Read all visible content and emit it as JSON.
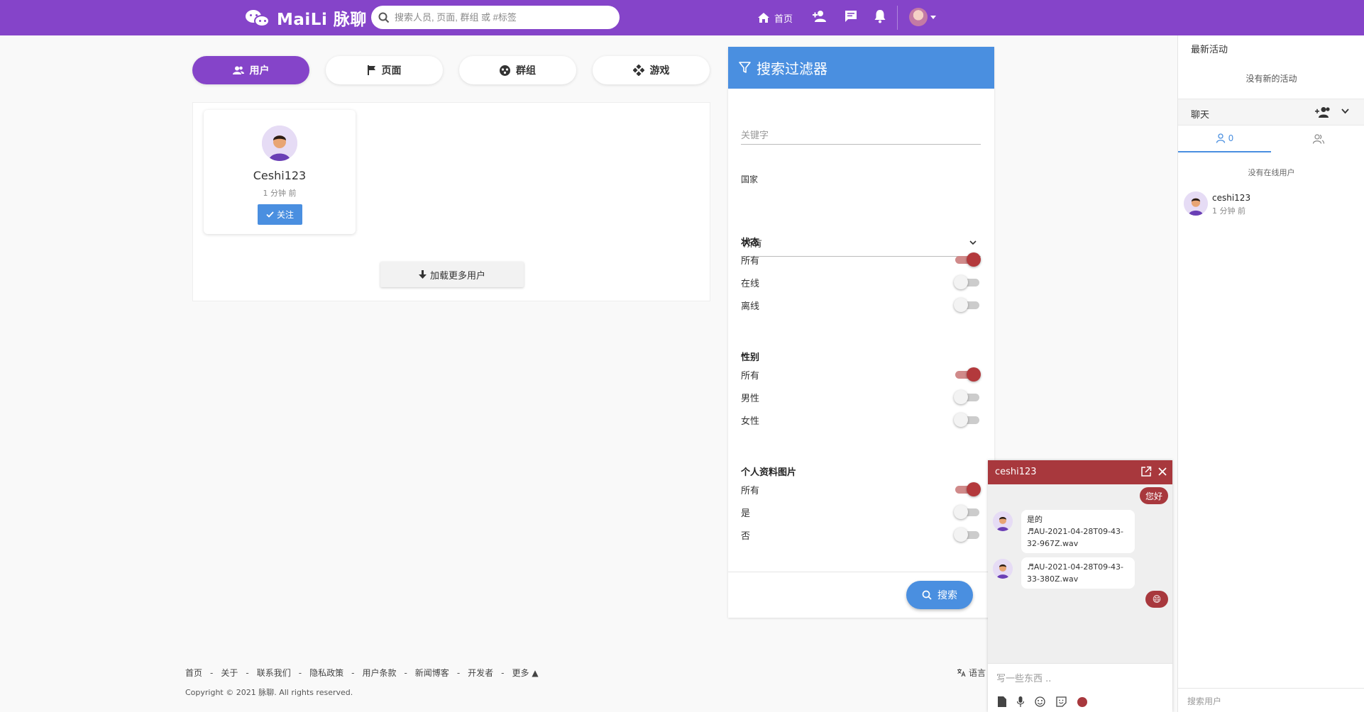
{
  "app": {
    "brand": "MaiLi 脉聊",
    "search_placeholder": "搜索人员, 页面, 群组 或 #标签",
    "nav_home": "首页"
  },
  "tabs": [
    {
      "label": "用户",
      "icon": "users-icon",
      "active": true
    },
    {
      "label": "页面",
      "icon": "flag-icon",
      "active": false
    },
    {
      "label": "群组",
      "icon": "group-icon",
      "active": false
    },
    {
      "label": "游戏",
      "icon": "gamepad-icon",
      "active": false
    }
  ],
  "users": {
    "card": {
      "name": "Ceshi123",
      "time": "1 分钟 前",
      "follow_label": "关注"
    },
    "load_more": "加载更多用户"
  },
  "filter": {
    "title": "搜索过滤器",
    "keyword_placeholder": "关键字",
    "country_label": "国家",
    "country_value": "所有",
    "status_title": "状态",
    "status_options": [
      {
        "label": "所有",
        "on": true
      },
      {
        "label": "在线",
        "on": false
      },
      {
        "label": "离线",
        "on": false
      }
    ],
    "gender_title": "性别",
    "gender_options": [
      {
        "label": "所有",
        "on": true
      },
      {
        "label": "男性",
        "on": false
      },
      {
        "label": "女性",
        "on": false
      }
    ],
    "photo_title": "个人资料图片",
    "photo_options": [
      {
        "label": "所有",
        "on": true
      },
      {
        "label": "是",
        "on": false
      },
      {
        "label": "否",
        "on": false
      }
    ],
    "search_button": "搜索"
  },
  "sidebar": {
    "activity_title": "最新活动",
    "no_activity": "没有新的活动",
    "chat_label": "聊天",
    "online_count": "0",
    "no_online": "没有在线用户",
    "user": {
      "name": "ceshi123",
      "time": "1 分钟 前"
    },
    "search_users": "搜索用户"
  },
  "chat": {
    "name": "ceshi123",
    "msg_me_1": "您好",
    "msg_them_1_text": "是的",
    "msg_them_1_file": "AU-2021-04-28T09-43-32-967Z.wav",
    "msg_them_2_file": "AU-2021-04-28T09-43-33-380Z.wav",
    "msg_me_2": "😄",
    "input_placeholder": "写一些东西 .."
  },
  "footer": {
    "links": [
      "首页",
      "关于",
      "联系我们",
      "隐私政策",
      "用户条款",
      "新闻博客",
      "开发者",
      "更多"
    ],
    "language": "语言",
    "copyright": "Copyright © 2021 脉聊. All rights reserved."
  },
  "colors": {
    "brand_purple": "#8544c9",
    "filter_blue": "#4a8fe0",
    "chat_red": "#a8383d"
  }
}
